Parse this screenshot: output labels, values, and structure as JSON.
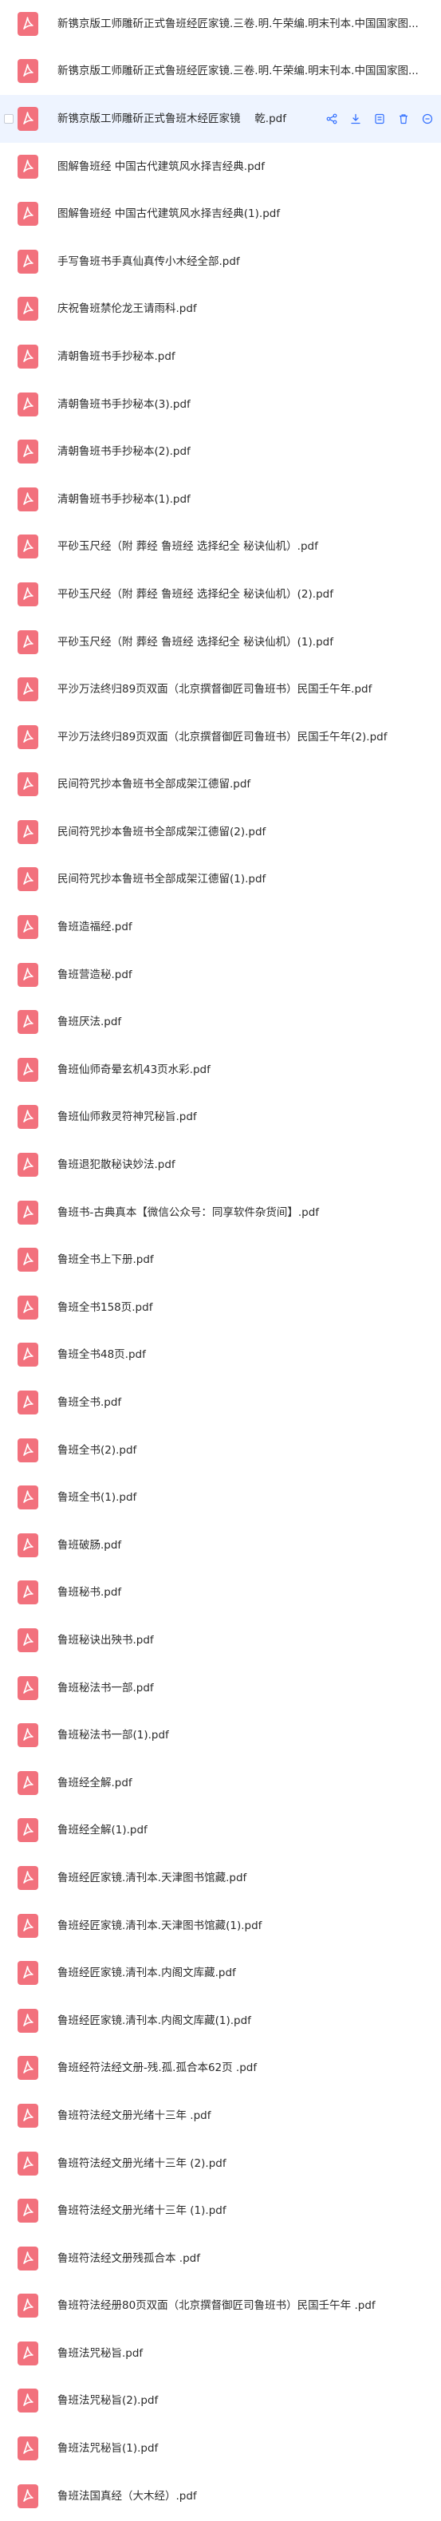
{
  "colors": {
    "pdf_icon": "#f2717d",
    "accent": "#3370ff",
    "selected_row": "#eef4ff"
  },
  "row_actions": [
    "share-icon",
    "download-icon",
    "copy-icon",
    "delete-icon",
    "more-icon"
  ],
  "files": [
    "新镌京版工师雕斫正式鲁班经匠家镜.三卷.明.午荣编.明末刊本.中国国家图...",
    "新镌京版工师雕斫正式鲁班经匠家镜.三卷.明.午荣编.明末刊本.中国国家图...",
    "新镌京版工师雕斫正式鲁班木经匠家镜 　乾.pdf",
    "图解鲁班经 中国古代建筑风水择吉经典.pdf",
    "图解鲁班经 中国古代建筑风水择吉经典(1).pdf",
    "手写鲁班书手真仙真传小木经全部.pdf",
    "庆祝鲁班禁伦龙王请雨科.pdf",
    "清朝鲁班书手抄秘本.pdf",
    "清朝鲁班书手抄秘本(3).pdf",
    "清朝鲁班书手抄秘本(2).pdf",
    "清朝鲁班书手抄秘本(1).pdf",
    "平砂玉尺经（附 葬经 鲁班经 选择纪全 秘诀仙机）.pdf",
    "平砂玉尺经（附 葬经 鲁班经 选择纪全 秘诀仙机）(2).pdf",
    "平砂玉尺经（附 葬经 鲁班经 选择纪全 秘诀仙机）(1).pdf",
    "平沙万法终归89页双面（北京撰督御匠司鲁班书）民国壬午年.pdf",
    "平沙万法终归89页双面（北京撰督御匠司鲁班书）民国壬午年(2).pdf",
    "民间符咒抄本鲁班书全部成架江德留.pdf",
    "民间符咒抄本鲁班书全部成架江德留(2).pdf",
    "民间符咒抄本鲁班书全部成架江德留(1).pdf",
    "鲁班造福经.pdf",
    "鲁班营造秘.pdf",
    "鲁班厌法.pdf",
    "鲁班仙师奇晕玄机43页水彩.pdf",
    "鲁班仙师救灵符神咒秘旨.pdf",
    "鲁班退犯散秘诀妙法.pdf",
    "鲁班书-古典真本【微信公众号：同享软件杂货间】.pdf",
    "鲁班全书上下册.pdf",
    "鲁班全书158页.pdf",
    "鲁班全书48页.pdf",
    "鲁班全书.pdf",
    "鲁班全书(2).pdf",
    "鲁班全书(1).pdf",
    "鲁班破肠.pdf",
    "鲁班秘书.pdf",
    "鲁班秘诀出殃书.pdf",
    "鲁班秘法书一部.pdf",
    "鲁班秘法书一部(1).pdf",
    "鲁班经全解.pdf",
    "鲁班经全解(1).pdf",
    "鲁班经匠家镜.清刊本.天津图书馆藏.pdf",
    "鲁班经匠家镜.清刊本.天津图书馆藏(1).pdf",
    "鲁班经匠家镜.清刊本.内阁文库藏.pdf",
    "鲁班经匠家镜.清刊本.内阁文库藏(1).pdf",
    "鲁班经符法经文册-残.孤.孤合本62页 .pdf",
    "鲁班符法经文册光绪十三年 .pdf",
    "鲁班符法经文册光绪十三年 (2).pdf",
    "鲁班符法经文册光绪十三年 (1).pdf",
    "鲁班符法经文册残孤合本 .pdf",
    "鲁班符法经册80页双面（北京撰督御匠司鲁班书）民国壬午年 .pdf",
    "鲁班法咒秘旨.pdf",
    "鲁班法咒秘旨(2).pdf",
    "鲁班法咒秘旨(1).pdf",
    "鲁班法国真经（大木经）.pdf"
  ]
}
